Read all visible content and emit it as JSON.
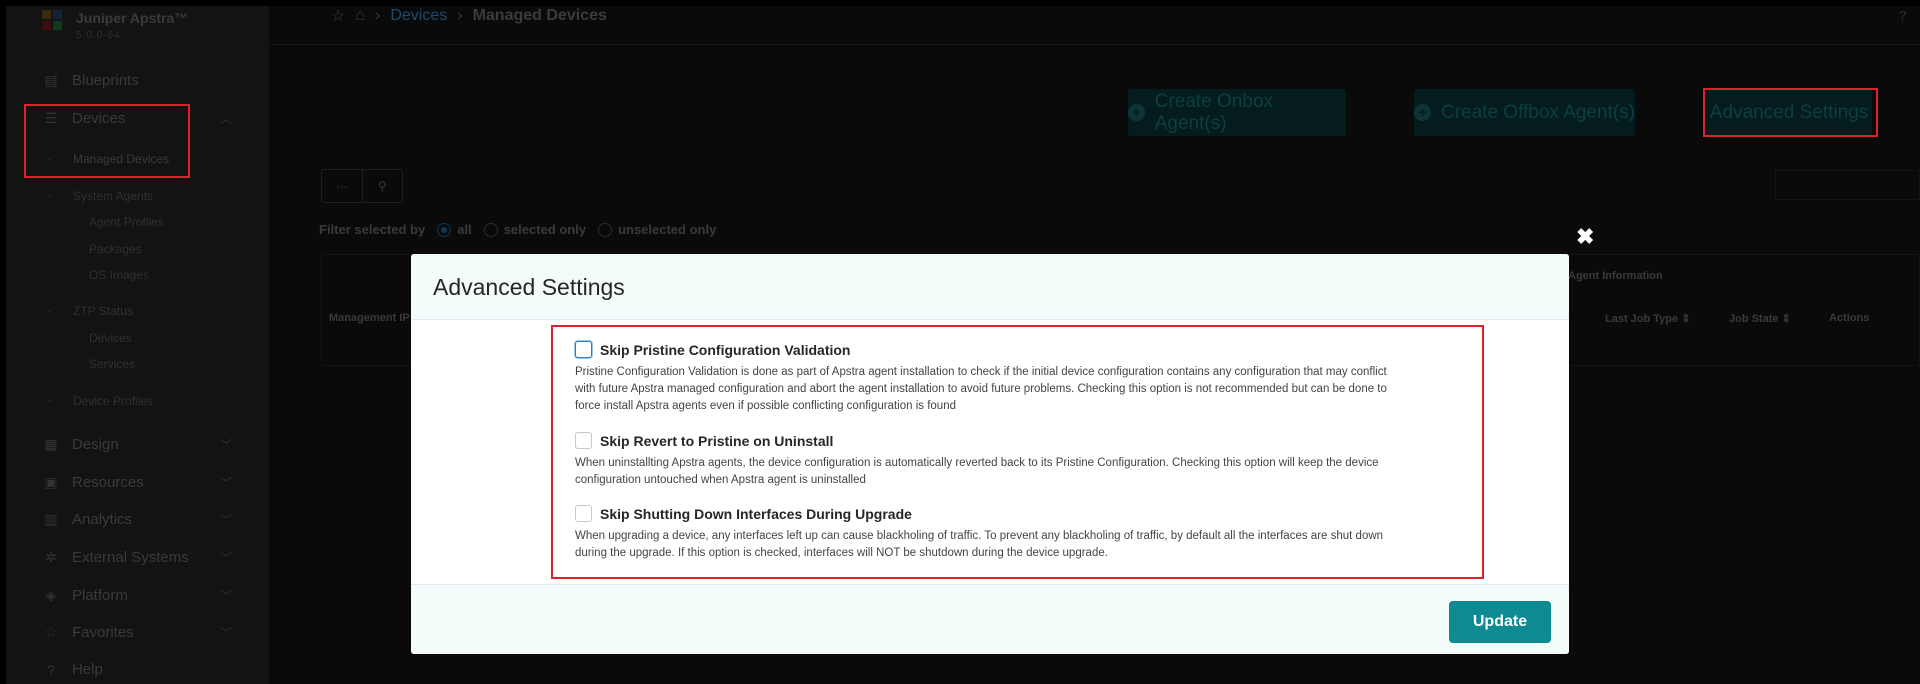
{
  "app": {
    "name": "Juniper Apstra™",
    "version": "5.0.0-64"
  },
  "sidebar": {
    "blueprints": "Blueprints",
    "devices": "Devices",
    "managed_devices": "Managed Devices",
    "system_agents": "System Agents",
    "agent_profiles": "Agent Profiles",
    "packages": "Packages",
    "os_images": "OS Images",
    "ztp_status": "ZTP Status",
    "ztp_devices": "Devices",
    "ztp_services": "Services",
    "device_profiles": "Device Profiles",
    "design": "Design",
    "resources": "Resources",
    "analytics": "Analytics",
    "external_systems": "External Systems",
    "platform": "Platform",
    "favorites": "Favorites",
    "help": "Help"
  },
  "breadcrumb": {
    "devices": "Devices",
    "separator": "›",
    "current": "Managed Devices"
  },
  "help_mark": "?",
  "toolbar": {
    "create_onbox": "Create Onbox Agent(s)",
    "create_offbox": "Create Offbox Agent(s)",
    "advanced_settings": "Advanced Settings",
    "more": "···"
  },
  "filter": {
    "label": "Filter selected by",
    "options": [
      "all",
      "selected only",
      "unselected only"
    ],
    "selected": "all"
  },
  "table": {
    "headers": {
      "management_ip": "Management IP",
      "agent_information": "Agent Information",
      "last_job_type": "Last Job Type ⇕",
      "job_state": "Job State ⇕",
      "actions": "Actions"
    }
  },
  "modal": {
    "title": "Advanced Settings",
    "close": "✖",
    "options": [
      {
        "label": "Skip Pristine Configuration Validation",
        "checked": false,
        "description": "Pristine Configuration Validation is done as part of Apstra agent installation to check if the initial device configuration contains any configuration that may conflict with future Apstra managed configuration and abort the agent installation to avoid future problems. Checking this option is not recommended but can be done to force install Apstra agents even if possible conflicting configuration is found"
      },
      {
        "label": "Skip Revert to Pristine on Uninstall",
        "checked": false,
        "description": "When uninstallting Apstra agents, the device configuration is automatically reverted back to its Pristine Configuration. Checking this option will keep the device configuration untouched when Apstra agent is uninstalled"
      },
      {
        "label": "Skip Shutting Down Interfaces During Upgrade",
        "checked": false,
        "description": "When upgrading a device, any interfaces left up can cause blackholing of traffic. To prevent any blackholing of traffic, by default all the interfaces are shut down during the upgrade. If this option is checked, interfaces will NOT be shutdown during the device upgrade."
      }
    ],
    "update_label": "Update"
  },
  "colors": {
    "accent": "#0e8a93",
    "highlight": "#e0202a"
  }
}
